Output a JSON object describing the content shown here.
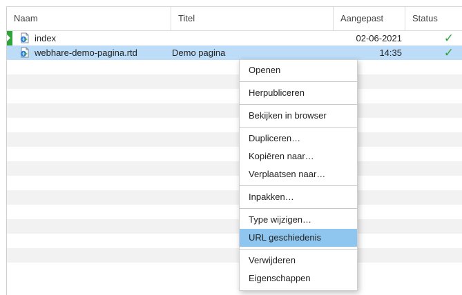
{
  "columns": {
    "naam": "Naam",
    "titel": "Titel",
    "aangepast": "Aangepast",
    "status": "Status"
  },
  "rows": [
    {
      "name": "index",
      "title": "",
      "date": "02-06-2021",
      "status": "✓",
      "expandable": true,
      "selected": false
    },
    {
      "name": "webhare-demo-pagina.rtd",
      "title": "Demo pagina",
      "date": "14:35",
      "status": "✓",
      "expandable": false,
      "selected": true
    }
  ],
  "empty_rows": 15,
  "context_menu": {
    "groups": [
      [
        "Openen"
      ],
      [
        "Herpubliceren"
      ],
      [
        "Bekijken in browser"
      ],
      [
        "Dupliceren…",
        "Kopiëren naar…",
        "Verplaatsen naar…"
      ],
      [
        "Inpakken…"
      ],
      [
        "Type wijzigen…",
        "URL geschiedenis"
      ],
      [
        "Verwijderen",
        "Eigenschappen"
      ]
    ],
    "highlighted": "URL geschiedenis"
  },
  "colors": {
    "selected_row": "#bcdcf7",
    "menu_highlight": "#8fc6ef",
    "status_ok": "#35a23a",
    "expander": "#2fa23a"
  },
  "icons": {
    "file": "webpage-file-icon",
    "status": "checkmark-icon",
    "expander": "expand-arrow-icon"
  }
}
